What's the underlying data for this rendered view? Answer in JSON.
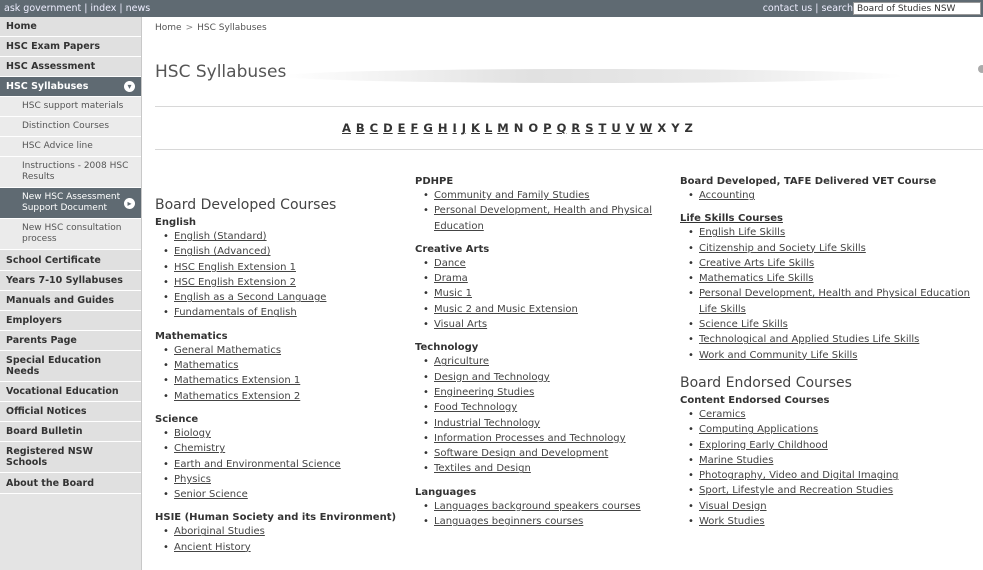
{
  "topbar": {
    "left_links": [
      "ask government",
      "index",
      "news"
    ],
    "right_links": [
      "contact us",
      "search"
    ],
    "search_value": "Board of Studies NSW"
  },
  "sidebar": {
    "items": [
      {
        "label": "Home",
        "level": 1
      },
      {
        "label": "HSC Exam Papers",
        "level": 1
      },
      {
        "label": "HSC Assessment",
        "level": 1
      },
      {
        "label": "HSC Syllabuses",
        "level": 1,
        "active": true,
        "icon": "chevron-down-circle-icon"
      },
      {
        "label": "HSC support materials",
        "level": 2
      },
      {
        "label": "Distinction Courses",
        "level": 2
      },
      {
        "label": "HSC Advice line",
        "level": 2
      },
      {
        "label": "Instructions - 2008 HSC Results",
        "level": 2
      },
      {
        "label": "New HSC Assessment Support Document",
        "level": 2,
        "active": true,
        "icon": "chevron-right-circle-icon"
      },
      {
        "label": "New HSC consultation process",
        "level": 2
      },
      {
        "label": "School Certificate",
        "level": 1
      },
      {
        "label": "Years 7-10 Syllabuses",
        "level": 1
      },
      {
        "label": "Manuals and Guides",
        "level": 1
      },
      {
        "label": "Employers",
        "level": 1
      },
      {
        "label": "Parents Page",
        "level": 1
      },
      {
        "label": "Special Education Needs",
        "level": 1
      },
      {
        "label": "Vocational Education",
        "level": 1
      },
      {
        "label": "Official Notices",
        "level": 1
      },
      {
        "label": "Board Bulletin",
        "level": 1
      },
      {
        "label": "Registered NSW Schools",
        "level": 1
      },
      {
        "label": "About the Board",
        "level": 1
      }
    ]
  },
  "breadcrumb": {
    "items": [
      "Home",
      "HSC Syllabuses"
    ],
    "separator": ">"
  },
  "page_title": "HSC Syllabuses",
  "alphabet": [
    {
      "letter": "A",
      "link": true
    },
    {
      "letter": "B",
      "link": true
    },
    {
      "letter": "C",
      "link": true
    },
    {
      "letter": "D",
      "link": true
    },
    {
      "letter": "E",
      "link": true
    },
    {
      "letter": "F",
      "link": true
    },
    {
      "letter": "G",
      "link": true
    },
    {
      "letter": "H",
      "link": true
    },
    {
      "letter": "I",
      "link": true
    },
    {
      "letter": "J",
      "link": true
    },
    {
      "letter": "K",
      "link": true
    },
    {
      "letter": "L",
      "link": true
    },
    {
      "letter": "M",
      "link": true
    },
    {
      "letter": "N",
      "link": false
    },
    {
      "letter": "O",
      "link": false
    },
    {
      "letter": "P",
      "link": true
    },
    {
      "letter": "Q",
      "link": true
    },
    {
      "letter": "R",
      "link": true
    },
    {
      "letter": "S",
      "link": true
    },
    {
      "letter": "T",
      "link": true
    },
    {
      "letter": "U",
      "link": true
    },
    {
      "letter": "V",
      "link": true
    },
    {
      "letter": "W",
      "link": true
    },
    {
      "letter": "X",
      "link": false
    },
    {
      "letter": "Y",
      "link": false
    },
    {
      "letter": "Z",
      "link": false
    }
  ],
  "columns": [
    {
      "blocks": [
        {
          "type": "group",
          "title": "Board Developed Courses"
        },
        {
          "type": "section",
          "title": "English",
          "items": [
            "English (Standard)",
            "English (Advanced)",
            "HSC English Extension 1",
            "HSC English Extension 2",
            "English as a Second Language",
            "Fundamentals of English"
          ]
        },
        {
          "type": "section",
          "title": "Mathematics",
          "items": [
            "General Mathematics",
            "Mathematics",
            "Mathematics Extension 1",
            "Mathematics Extension 2"
          ]
        },
        {
          "type": "section",
          "title": "Science",
          "items": [
            "Biology",
            "Chemistry",
            "Earth and Environmental Science",
            "Physics",
            "Senior Science"
          ]
        },
        {
          "type": "section",
          "title": "HSIE (Human Society and its Environment)",
          "items": [
            "Aboriginal Studies",
            "Ancient History"
          ]
        }
      ]
    },
    {
      "blocks": [
        {
          "type": "section",
          "title": "PDHPE",
          "items": [
            "Community and Family Studies",
            "Personal Development, Health and Physical Education"
          ]
        },
        {
          "type": "section",
          "title": "Creative Arts",
          "items": [
            "Dance",
            "Drama",
            "Music 1",
            "Music 2 and Music Extension",
            "Visual Arts"
          ]
        },
        {
          "type": "section",
          "title": "Technology",
          "items": [
            "Agriculture",
            "Design and Technology",
            "Engineering Studies",
            "Food Technology",
            "Industrial Technology",
            "Information Processes and Technology",
            "Software Design and Development",
            "Textiles and Design"
          ]
        },
        {
          "type": "section",
          "title": "Languages",
          "items": [
            "Languages background speakers courses",
            "Languages beginners courses"
          ]
        }
      ]
    },
    {
      "blocks": [
        {
          "type": "section",
          "title": "Board Developed, TAFE Delivered VET Course",
          "items": [
            "Accounting"
          ]
        },
        {
          "type": "section",
          "title": "Life Skills Courses",
          "underline": true,
          "items": [
            "English Life Skills",
            "Citizenship and Society Life Skills",
            "Creative Arts Life Skills",
            "Mathematics Life Skills",
            "Personal Development, Health and Physical Education Life Skills",
            "Science Life Skills",
            "Technological and Applied Studies Life Skills",
            "Work and Community Life Skills"
          ]
        },
        {
          "type": "group",
          "title": "Board Endorsed Courses"
        },
        {
          "type": "section",
          "title": "Content Endorsed Courses",
          "items": [
            "Ceramics",
            "Computing Applications",
            "Exploring Early Childhood",
            "Marine Studies",
            "Photography, Video and Digital Imaging",
            "Sport, Lifestyle and Recreation Studies",
            "Visual Design",
            "Work Studies"
          ]
        }
      ]
    }
  ]
}
